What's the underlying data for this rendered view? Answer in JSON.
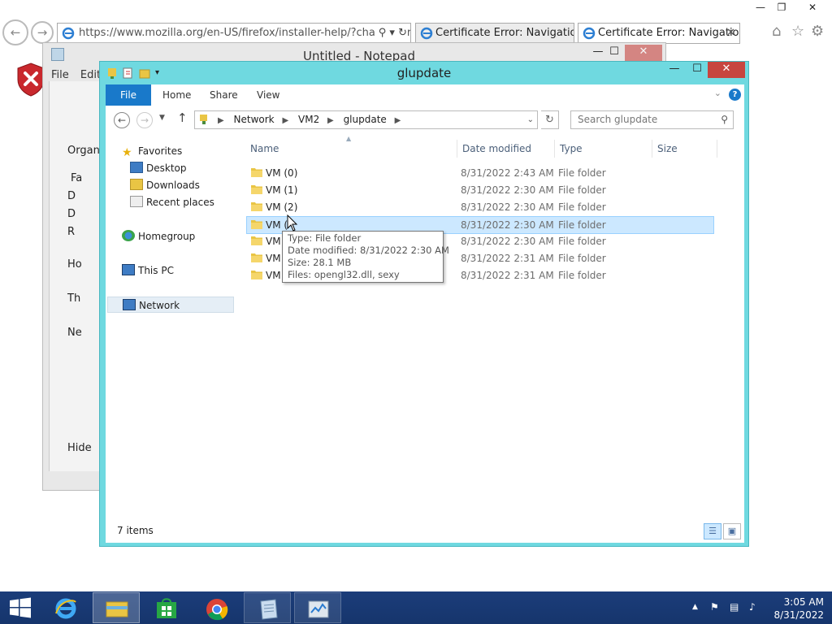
{
  "ie": {
    "address": "https://www.mozilla.org/en-US/firefox/installer-help/?channel=rele",
    "address_domain": "mozilla.org",
    "tabs": [
      "Certificate Error: Navigation Bl...",
      "Certificate Error: Navigation..."
    ]
  },
  "notepad": {
    "title": "Untitled - Notepad",
    "menu": [
      "File",
      "Edit"
    ]
  },
  "explorer_back": {
    "items": [
      "Organi",
      "Fa",
      "D",
      "D",
      "R",
      "Ho",
      "Th",
      "Ne",
      "Hide"
    ]
  },
  "explorer": {
    "title": "glupdate",
    "ribbon": {
      "file": "File",
      "home": "Home",
      "share": "Share",
      "view": "View"
    },
    "breadcrumb": [
      "Network",
      "VM2",
      "glupdate"
    ],
    "search_placeholder": "Search glupdate",
    "nav": {
      "favorites": "Favorites",
      "desktop": "Desktop",
      "downloads": "Downloads",
      "recent": "Recent places",
      "homegroup": "Homegroup",
      "thispc": "This PC",
      "network": "Network"
    },
    "columns": {
      "name": "Name",
      "date": "Date modified",
      "type": "Type",
      "size": "Size"
    },
    "files": [
      {
        "name": "VM (0)",
        "date": "8/31/2022 2:43 AM",
        "type": "File folder"
      },
      {
        "name": "VM (1)",
        "date": "8/31/2022 2:30 AM",
        "type": "File folder"
      },
      {
        "name": "VM (2)",
        "date": "8/31/2022 2:30 AM",
        "type": "File folder"
      },
      {
        "name": "VM (",
        "date": "8/31/2022 2:30 AM",
        "type": "File folder"
      },
      {
        "name": "VM (",
        "date": "8/31/2022 2:30 AM",
        "type": "File folder"
      },
      {
        "name": "VM (",
        "date": "8/31/2022 2:31 AM",
        "type": "File folder"
      },
      {
        "name": "VM (",
        "date": "8/31/2022 2:31 AM",
        "type": "File folder"
      }
    ],
    "tooltip": {
      "type": "Type: File folder",
      "date": "Date modified: 8/31/2022 2:30 AM",
      "size": "Size: 28.1 MB",
      "files": "Files: opengl32.dll, sexy"
    },
    "status": "7 items"
  },
  "taskbar": {
    "time": "3:05 AM",
    "date": "8/31/2022"
  },
  "colors": {
    "explorer_frame": "#6fd9e0",
    "file_tab": "#1979ca",
    "selection": "#cce8ff",
    "taskbar": "#1b3d7a",
    "close_button": "#c7453f"
  }
}
